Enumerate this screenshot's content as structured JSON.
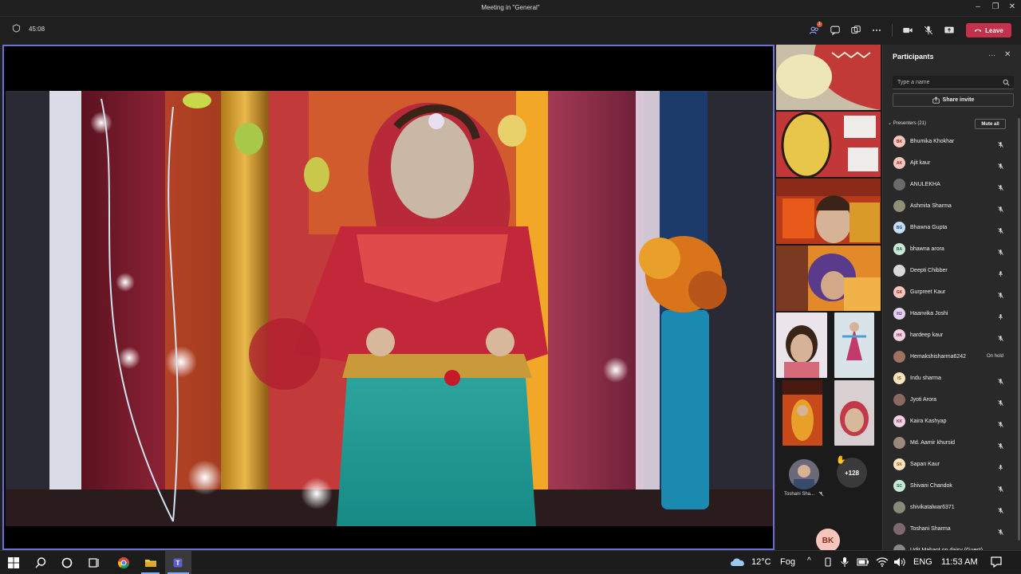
{
  "window": {
    "title": "Meeting in \"General\""
  },
  "toolbar": {
    "timer": "45:08",
    "participants_badge": "1",
    "leave_label": "Leave"
  },
  "strip": {
    "tile_name": "Toshani Sha...",
    "overflow_count": "+128",
    "self_initials": "BK"
  },
  "panel": {
    "title": "Participants",
    "search_placeholder": "Type a name",
    "share_invite": "Share invite",
    "section": "Presenters (21)",
    "mute_all": "Mute all",
    "participants": [
      {
        "initials": "BK",
        "name": "Bhumika Khokhar",
        "color": "#f6c6bd",
        "fg": "#8a2c1c",
        "mic": "muted",
        "status": ""
      },
      {
        "initials": "AK",
        "name": "Ajit kaur",
        "color": "#f6c6bd",
        "fg": "#8a2c1c",
        "mic": "muted",
        "status": ""
      },
      {
        "initials": "",
        "name": "ANULEKHA",
        "color": "#6b6b6b",
        "fg": "#fff",
        "mic": "muted",
        "status": ""
      },
      {
        "initials": "",
        "name": "Ashmita Sharma",
        "color": "#8f8f7a",
        "fg": "#fff",
        "mic": "muted",
        "status": ""
      },
      {
        "initials": "BG",
        "name": "Bhawna Gupta",
        "color": "#c7dcf5",
        "fg": "#1c4f8a",
        "mic": "muted",
        "status": ""
      },
      {
        "initials": "BA",
        "name": "bhawna arora",
        "color": "#c9e8d7",
        "fg": "#1d6b43",
        "mic": "muted",
        "status": ""
      },
      {
        "initials": "",
        "name": "Deepti Chibber",
        "color": "#d9d9d9",
        "fg": "#333",
        "mic": "on",
        "status": ""
      },
      {
        "initials": "GK",
        "name": "Gurpreet Kaur",
        "color": "#f6c6bd",
        "fg": "#8a2c1c",
        "mic": "muted",
        "status": ""
      },
      {
        "initials": "HJ",
        "name": "Haanvika Joshi",
        "color": "#e3d2f0",
        "fg": "#5a2a80",
        "mic": "on",
        "status": ""
      },
      {
        "initials": "HK",
        "name": "hardeep kaur",
        "color": "#f3d2e4",
        "fg": "#8a2c5c",
        "mic": "muted",
        "status": ""
      },
      {
        "initials": "",
        "name": "Hemakshisharma6242",
        "color": "#a07060",
        "fg": "#fff",
        "mic": "none",
        "status": "On hold"
      },
      {
        "initials": "IS",
        "name": "Indu sharma",
        "color": "#fbe3c0",
        "fg": "#8a5a1c",
        "mic": "muted",
        "status": ""
      },
      {
        "initials": "",
        "name": "Jyoti Arora",
        "color": "#8a6a60",
        "fg": "#fff",
        "mic": "muted",
        "status": ""
      },
      {
        "initials": "KK",
        "name": "Kaira Kashyap",
        "color": "#f3d2e4",
        "fg": "#8a2c5c",
        "mic": "muted",
        "status": ""
      },
      {
        "initials": "",
        "name": "Md. Aamir khursid",
        "color": "#9a8a7a",
        "fg": "#fff",
        "mic": "muted",
        "status": ""
      },
      {
        "initials": "SK",
        "name": "Sapan Kaur",
        "color": "#fbe3c0",
        "fg": "#8a5a1c",
        "mic": "on",
        "status": ""
      },
      {
        "initials": "SC",
        "name": "Shivani Chandok",
        "color": "#c9e8d7",
        "fg": "#1d6b43",
        "mic": "muted",
        "status": ""
      },
      {
        "initials": "",
        "name": "shivikatalwar6371",
        "color": "#8a8a7a",
        "fg": "#fff",
        "mic": "muted",
        "status": ""
      },
      {
        "initials": "",
        "name": "Toshani Sharma",
        "color": "#7a6a70",
        "fg": "#fff",
        "mic": "muted",
        "status": ""
      },
      {
        "initials": "",
        "name": "Udit Mahant on daisy (Guest)",
        "color": "#888",
        "fg": "#fff",
        "mic": "muted",
        "status": ""
      }
    ]
  },
  "taskbar": {
    "weather_temp": "12°C",
    "weather_cond": "Fog",
    "lang": "ENG",
    "time": "11:53 AM"
  },
  "colors": {
    "accent": "#6c6fd4",
    "leave": "#c4314b",
    "panel_bg": "#292929"
  }
}
